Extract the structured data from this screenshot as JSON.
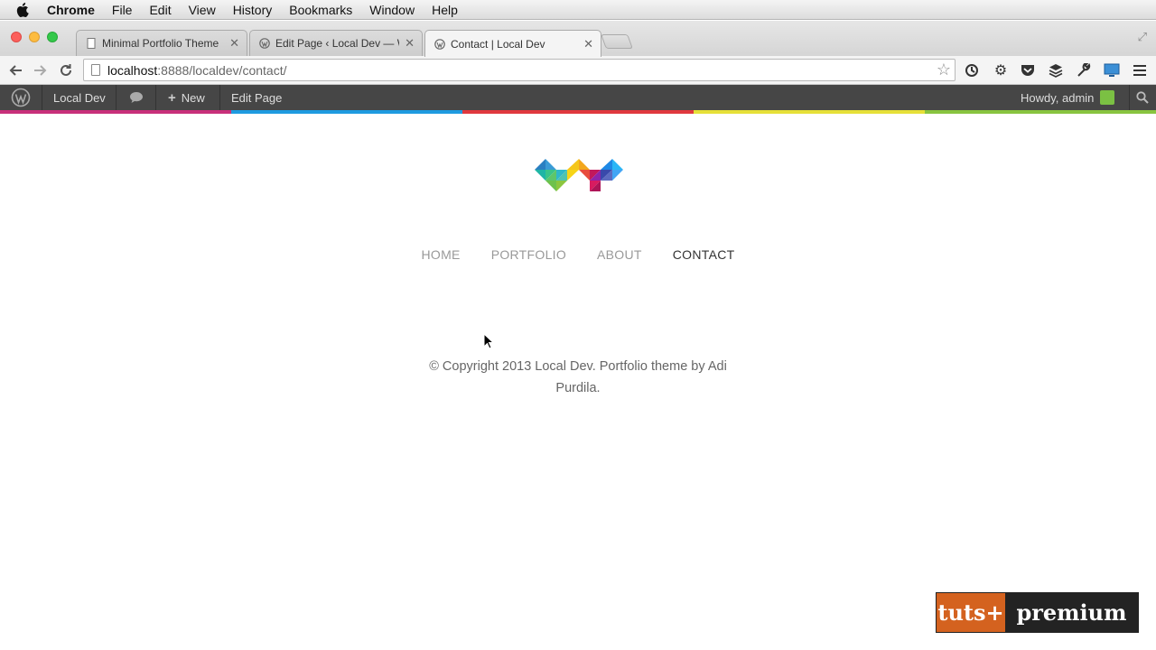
{
  "menubar": {
    "app": "Chrome",
    "items": [
      "File",
      "Edit",
      "View",
      "History",
      "Bookmarks",
      "Window",
      "Help"
    ]
  },
  "tabs": [
    {
      "title": "Minimal Portfolio Theme",
      "icon": "page-icon",
      "active": false
    },
    {
      "title": "Edit Page ‹ Local Dev — Wo",
      "icon": "wordpress-icon",
      "active": false
    },
    {
      "title": "Contact | Local Dev",
      "icon": "wordpress-icon",
      "active": true
    }
  ],
  "toolbar": {
    "url_host": "localhost",
    "url_path": ":8888/localdev/contact/",
    "extensions": [
      "sync-icon",
      "gear-icon",
      "pocket-icon",
      "buffer-icon",
      "wrench-icon",
      "screen-icon",
      "hamburger-menu-icon"
    ]
  },
  "adminbar": {
    "site_name": "Local Dev",
    "new_label": "New",
    "edit_label": "Edit Page",
    "howdy": "Howdy, admin",
    "strip_colors": [
      "#c8307a",
      "#1e9be0",
      "#e0393e",
      "#e6e038",
      "#88c43f"
    ]
  },
  "site": {
    "nav": [
      {
        "label": "HOME",
        "current": false
      },
      {
        "label": "PORTFOLIO",
        "current": false
      },
      {
        "label": "ABOUT",
        "current": false
      },
      {
        "label": "CONTACT",
        "current": true
      }
    ],
    "footer": "© Copyright 2013 Local Dev. Portfolio theme by Adi Purdila."
  },
  "badge": {
    "left": "tuts+",
    "right": "premium"
  }
}
